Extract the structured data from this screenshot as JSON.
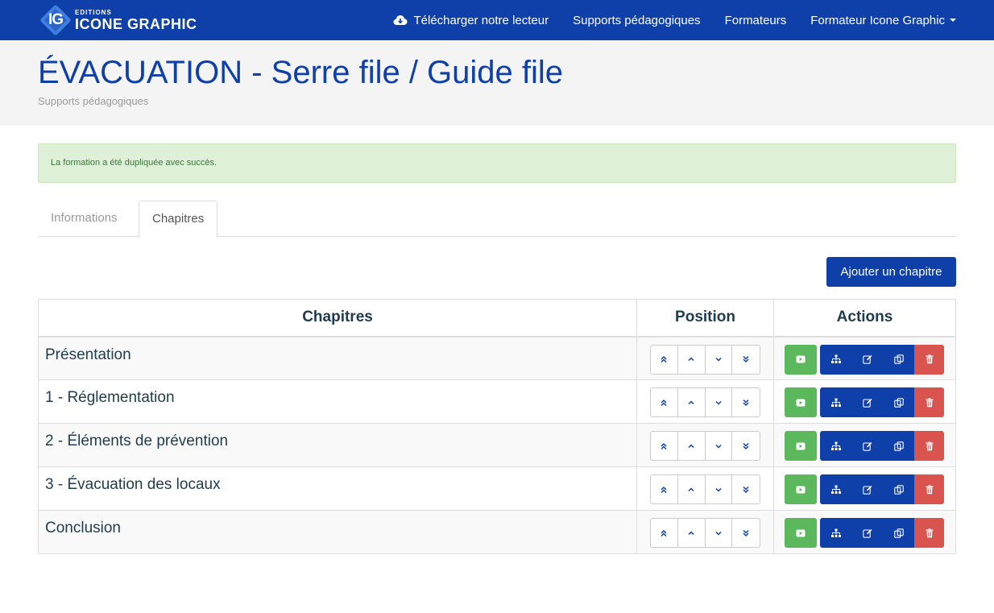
{
  "brand": {
    "logo_letters": "IG",
    "small": "EDITIONS",
    "big": "ICONE GRAPHIC"
  },
  "nav": {
    "download": "Télécharger notre lecteur",
    "supports": "Supports pédagogiques",
    "trainers": "Formateurs",
    "user": "Formateur Icone Graphic"
  },
  "header": {
    "title": "ÉVACUATION - Serre file / Guide file",
    "subtitle": "Supports pédagogiques"
  },
  "alert": {
    "message": "La formation a été dupliquée avec succès."
  },
  "tabs": {
    "informations": "Informations",
    "chapitres": "Chapitres",
    "active": "Chapitres"
  },
  "add_button": "Ajouter un chapitre",
  "table": {
    "headers": {
      "chapters": "Chapitres",
      "position": "Position",
      "actions": "Actions"
    },
    "rows": [
      {
        "name": "Présentation"
      },
      {
        "name": "1 - Réglementation"
      },
      {
        "name": "2 - Éléments de prévention"
      },
      {
        "name": "3 - Évacuation des locaux"
      },
      {
        "name": "Conclusion"
      }
    ]
  },
  "colors": {
    "primary": "#0f3fa8",
    "success": "#5cb85c",
    "danger": "#d9534f",
    "alert_bg": "#dff0d8"
  },
  "icons": {
    "download": "cloud-download-icon",
    "move_top": "double-chevron-up-icon",
    "move_up": "chevron-up-icon",
    "move_down": "chevron-down-icon",
    "move_bottom": "double-chevron-down-icon",
    "play": "play-icon",
    "structure": "sitemap-icon",
    "edit": "edit-icon",
    "duplicate": "copy-icon",
    "delete": "trash-icon"
  }
}
